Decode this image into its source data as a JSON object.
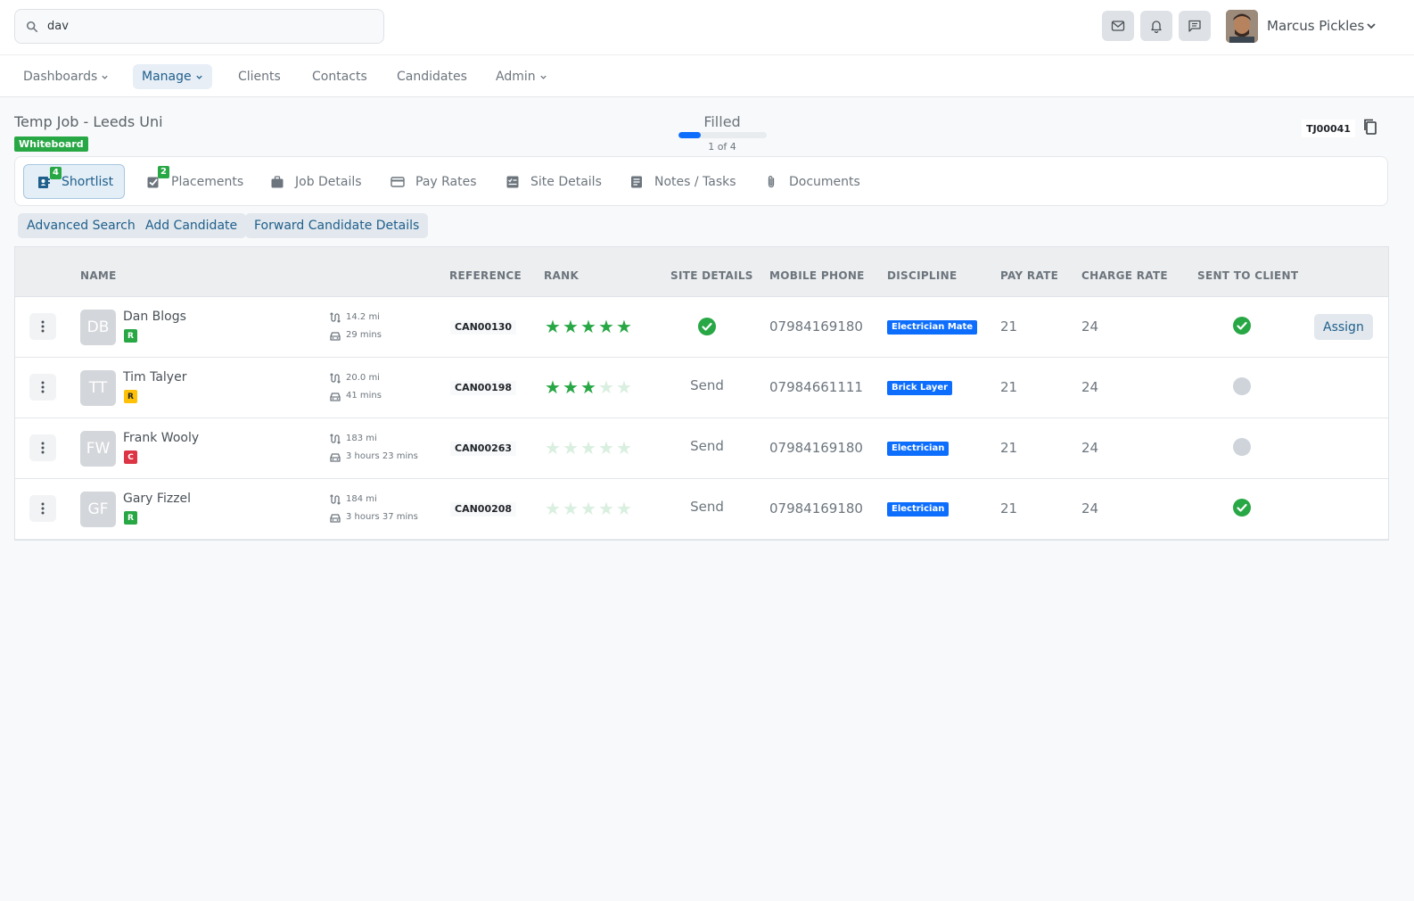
{
  "search": {
    "value": "dav"
  },
  "user": {
    "name": "Marcus Pickles"
  },
  "nav": {
    "items": [
      {
        "label": "Dashboards"
      },
      {
        "label": "Manage"
      },
      {
        "label": "Clients"
      },
      {
        "label": "Contacts"
      },
      {
        "label": "Candidates"
      },
      {
        "label": "Admin"
      }
    ]
  },
  "job": {
    "title": "Temp Job - Leeds Uni",
    "badge": "Whiteboard",
    "status": "Filled",
    "progress_fraction": 0.25,
    "progress_text": "1 of 4",
    "reference": "TJ00041"
  },
  "tabs": [
    {
      "label": "Shortlist",
      "badge": "4"
    },
    {
      "label": "Placements",
      "badge": "2"
    },
    {
      "label": "Job Details"
    },
    {
      "label": "Pay Rates"
    },
    {
      "label": "Site Details"
    },
    {
      "label": "Notes / Tasks"
    },
    {
      "label": "Documents"
    }
  ],
  "actions": {
    "advanced_search": "Advanced Search",
    "add_candidate": "Add Candidate",
    "forward_details": "Forward Candidate Details"
  },
  "table": {
    "headers": {
      "name": "NAME",
      "reference": "REFERENCE",
      "rank": "RANK",
      "site_details": "SITE DETAILS",
      "mobile_phone": "MOBILE PHONE",
      "discipline": "DISCIPLINE",
      "pay_rate": "PAY RATE",
      "charge_rate": "CHARGE RATE",
      "sent_to_client": "SENT TO CLIENT"
    },
    "rows": [
      {
        "initials": "DB",
        "name": "Dan Blogs",
        "status_letter": "R",
        "status_color": "#28a745",
        "distance": "14.2 mi",
        "drive_time": "29 mins",
        "reference": "CAN00130",
        "rank": 5,
        "site_details": "check",
        "mobile": "07984169180",
        "discipline": "Electrician Mate",
        "pay_rate": "21",
        "charge_rate": "24",
        "sent": true,
        "assign_label": "Assign"
      },
      {
        "initials": "TT",
        "name": "Tim Talyer",
        "status_letter": "R",
        "status_color": "#ffc107",
        "distance": "20.0 mi",
        "drive_time": "41 mins",
        "reference": "CAN00198",
        "rank": 3,
        "site_details": "Send",
        "mobile": "07984661111",
        "discipline": "Brick Layer",
        "pay_rate": "21",
        "charge_rate": "24",
        "sent": false
      },
      {
        "initials": "FW",
        "name": "Frank Wooly",
        "status_letter": "C",
        "status_color": "#dc3545",
        "distance": "183 mi",
        "drive_time": "3 hours 23 mins",
        "reference": "CAN00263",
        "rank": 0,
        "site_details": "Send",
        "mobile": "07984169180",
        "discipline": "Electrician",
        "pay_rate": "21",
        "charge_rate": "24",
        "sent": false
      },
      {
        "initials": "GF",
        "name": "Gary Fizzel",
        "status_letter": "R",
        "status_color": "#28a745",
        "distance": "184 mi",
        "drive_time": "3 hours 37 mins",
        "reference": "CAN00208",
        "rank": 0,
        "site_details": "Send",
        "mobile": "07984169180",
        "discipline": "Electrician",
        "pay_rate": "21",
        "charge_rate": "24",
        "sent": true
      }
    ]
  },
  "colors": {
    "accent": "#1f5f8b",
    "success": "#28a745",
    "primary": "#0d6efd"
  }
}
